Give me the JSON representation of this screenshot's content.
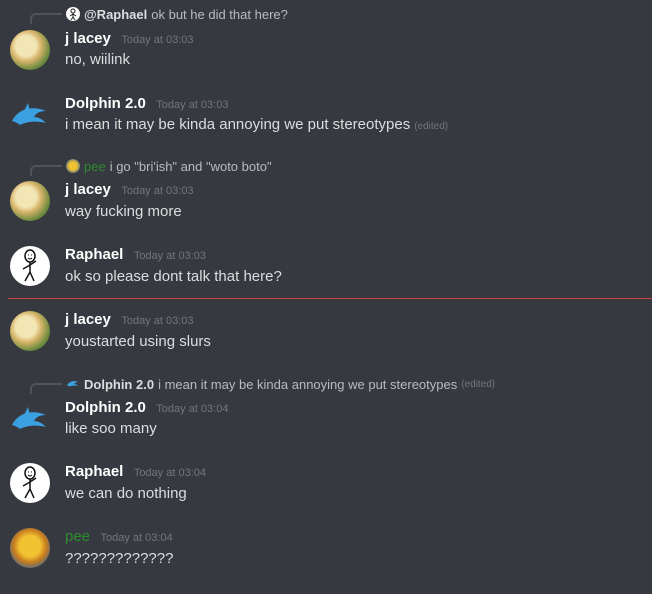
{
  "messages": [
    {
      "reply": {
        "name": "@Raphael",
        "text": "ok but he did that here?"
      },
      "user": "j lacey",
      "time": "Today at 03:03",
      "text": "no, wiilink"
    },
    {
      "user": "Dolphin 2.0",
      "time": "Today at 03:03",
      "text": "i mean it may be kinda annoying we put stereotypes",
      "edited": "(edited)"
    },
    {
      "reply": {
        "name": "pee",
        "text": "i go \"bri'ish\" and \"woto boto\""
      },
      "user": "j lacey",
      "time": "Today at 03:03",
      "text": "way fucking more"
    },
    {
      "user": "Raphael",
      "time": "Today at 03:03",
      "text": "ok so please dont talk that here?"
    },
    {
      "user": "j lacey",
      "time": "Today at 03:03",
      "text": "youstarted using slurs"
    },
    {
      "reply": {
        "name": "Dolphin 2.0",
        "text": "i mean it may be kinda annoying we put stereotypes",
        "edited": "(edited)"
      },
      "user": "Dolphin 2.0",
      "time": "Today at 03:04",
      "text": "like soo many"
    },
    {
      "user": "Raphael",
      "time": "Today at 03:04",
      "text": "we can do nothing"
    },
    {
      "user": "pee",
      "time": "Today at 03:04",
      "text": "?????????????"
    }
  ],
  "colors": {
    "background": "#36393f",
    "new_message_divider": "#f04747",
    "pee_name": "#2e8b2e"
  }
}
